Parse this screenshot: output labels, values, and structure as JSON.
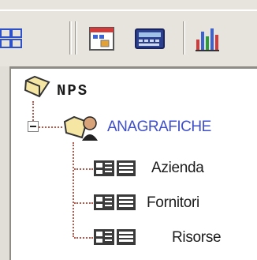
{
  "toolbar": {
    "icons": [
      "grid-icon",
      "window-icon",
      "calculator-icon",
      "bar-chart-icon"
    ]
  },
  "tree": {
    "root": {
      "label": "NPS",
      "icon": "folder-icon"
    },
    "group": {
      "label": "ANAGRAFICHE",
      "icon": "folder-user-icon",
      "expanded": true
    },
    "children": [
      {
        "label": "Azienda",
        "icon": "card-icon"
      },
      {
        "label": "Fornitori",
        "icon": "card-icon"
      },
      {
        "label": "Risorse",
        "icon": "card-icon"
      }
    ]
  },
  "colors": {
    "group_label": "#3f4fc9",
    "dotted_line": "#b45a4e"
  }
}
